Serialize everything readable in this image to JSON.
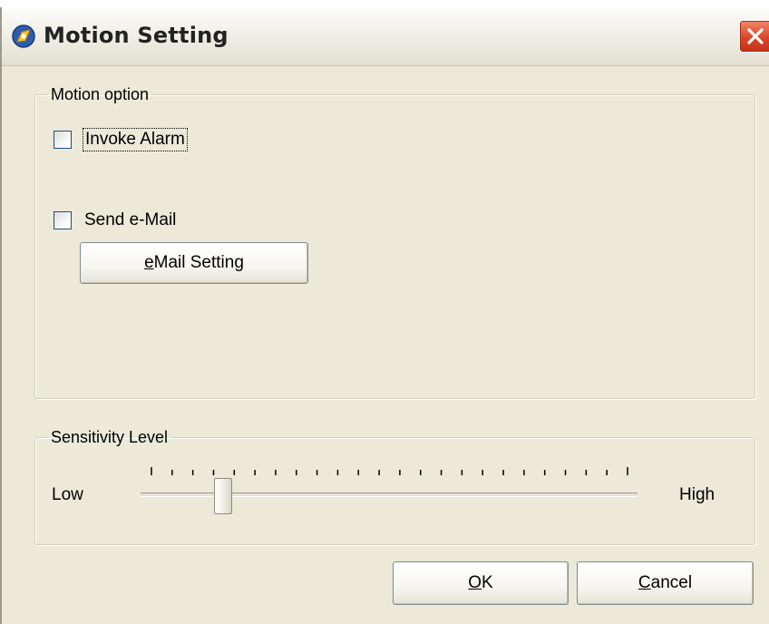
{
  "window": {
    "title": "Motion Setting"
  },
  "motion_option": {
    "legend": "Motion option",
    "invoke_alarm": {
      "label": "Invoke Alarm",
      "checked": false
    },
    "send_email": {
      "label": "Send e-Mail",
      "checked": false
    },
    "email_setting_button": {
      "mnemonic": "e",
      "rest": "Mail Setting"
    }
  },
  "sensitivity": {
    "legend": "Sensitivity Level",
    "low_label": "Low",
    "high_label": "High",
    "tick_count": 24,
    "level": 0.15
  },
  "buttons": {
    "ok": {
      "mnemonic": "O",
      "rest": "K"
    },
    "cancel": {
      "mnemonic": "C",
      "rest": "ancel"
    }
  },
  "colors": {
    "dialog_bg": "#ece9d8",
    "close_button": "#d8462a"
  }
}
